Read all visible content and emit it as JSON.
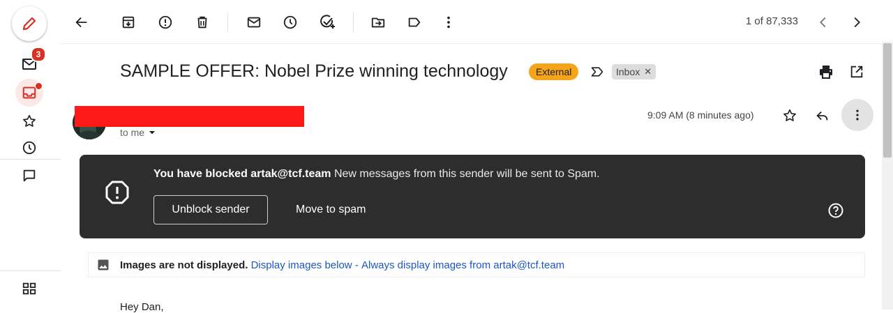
{
  "rail": {
    "inbox_badge": "3"
  },
  "toolbar": {
    "counter": "1 of 87,333"
  },
  "message": {
    "subject": "SAMPLE OFFER: Nobel Prize winning technology",
    "external_label": "External",
    "inbox_label": "Inbox",
    "recipient": "to me",
    "time": "9:09 AM (8 minutes ago)"
  },
  "banner": {
    "bold_text": "You have blocked artak@tcf.team",
    "text": "New messages from this sender will be sent to Spam.",
    "unblock_label": "Unblock sender",
    "move_label": "Move to spam"
  },
  "images_notice": {
    "bold_text": "Images are not displayed.",
    "display_below": "Display images below",
    "separator": "-",
    "always_display": "Always display images from artak@tcf.team"
  },
  "body": {
    "greeting": "Hey Dan,"
  },
  "colors": {
    "external_badge": "#f6a51b",
    "badge_red": "#d93025",
    "banner_bg": "#2d2d2d",
    "link": "#1a57c5"
  }
}
